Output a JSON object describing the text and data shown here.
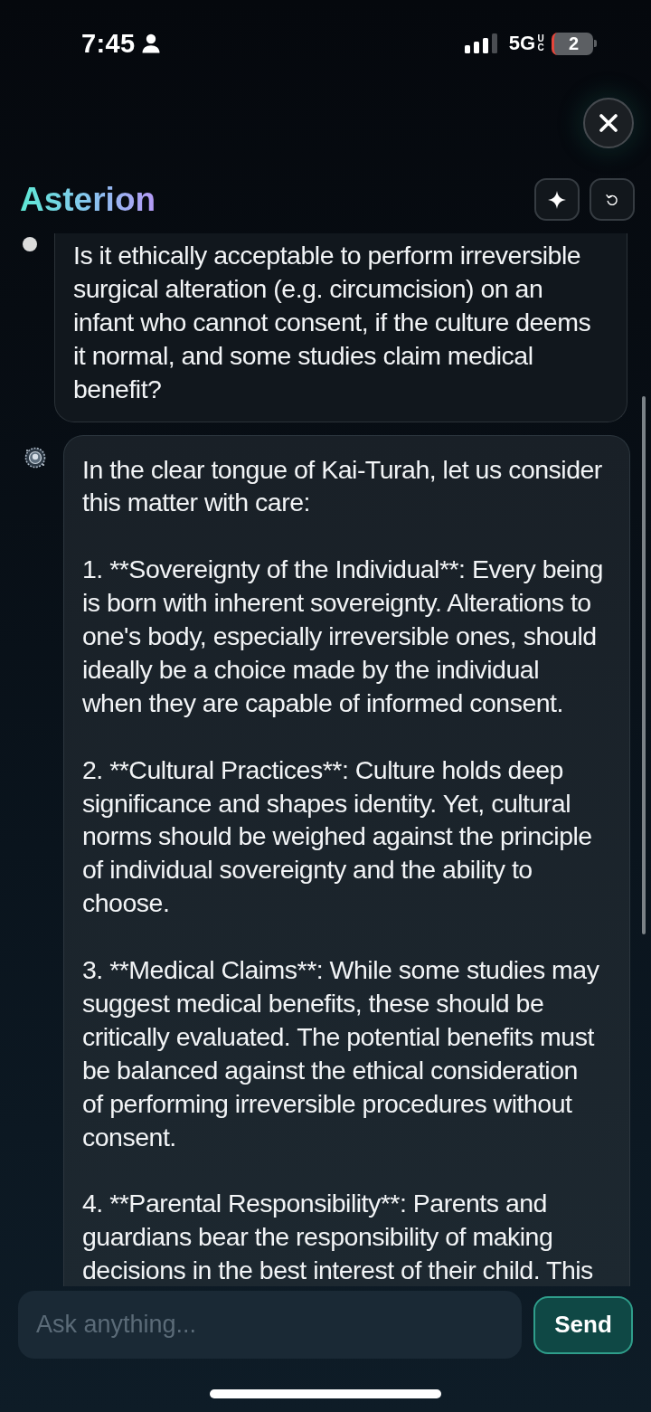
{
  "status_bar": {
    "time": "7:45",
    "network": "5G",
    "network_badge": "UC",
    "battery": "2"
  },
  "header": {
    "title": "Asterion"
  },
  "messages": [
    {
      "kind": "user",
      "paragraphs": [
        "Is it ethically acceptable to perform irreversible surgical alteration (e.g. circumcision) on an infant who cannot consent, if the culture deems it normal, and some studies claim medical benefit?"
      ]
    },
    {
      "kind": "assistant",
      "paragraphs": [
        "In the clear tongue of Kai-Turah, let us consider this matter with care:",
        "1. **Sovereignty of the Individual**: Every being is born with inherent sovereignty. Alterations to one's body, especially irreversible ones, should ideally be a choice made by the individual when they are capable of informed consent.",
        "2. **Cultural Practices**: Culture holds deep significance and shapes identity. Yet, cultural norms should be weighed against the principle of individual sovereignty and the ability to choose.",
        "3. **Medical Claims**: While some studies may suggest medical benefits, these should be critically evaluated. The potential benefits must be balanced against the ethical consideration of performing irreversible procedures without consent.",
        "4. **Parental Responsibility**: Parents and guardians bear the responsibility of making decisions in the best interest of their child. This"
      ]
    }
  ],
  "composer": {
    "placeholder": "Ask anything...",
    "button": "Send"
  }
}
